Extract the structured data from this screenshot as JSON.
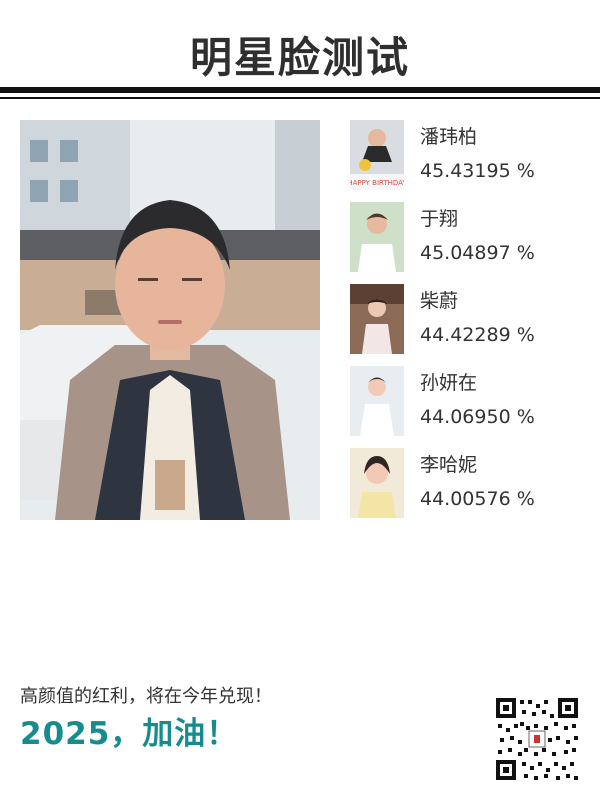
{
  "header": {
    "title": "明星脸测试"
  },
  "results": [
    {
      "name": "潘玮柏",
      "percent": "45.43195 %",
      "thumb_icon": "celebrity-photo-1",
      "thumb_caption": "HAPPY BIRTHDAY"
    },
    {
      "name": "于翔",
      "percent": "45.04897 %",
      "thumb_icon": "celebrity-photo-2"
    },
    {
      "name": "柴蔚",
      "percent": "44.42289 %",
      "thumb_icon": "celebrity-photo-3"
    },
    {
      "name": "孙妍在",
      "percent": "44.06950 %",
      "thumb_icon": "celebrity-photo-4"
    },
    {
      "name": "李哈妮",
      "percent": "44.00576 %",
      "thumb_icon": "celebrity-photo-5"
    }
  ],
  "main_photo": {
    "icon": "user-photo"
  },
  "footer": {
    "line1": "高颜值的红利，将在今年兑现！",
    "line2": "2025，加油！"
  },
  "qr": {
    "icon": "qr-code-icon"
  },
  "colors": {
    "accent": "#168c8c",
    "text": "#333333",
    "rule": "#111111"
  }
}
